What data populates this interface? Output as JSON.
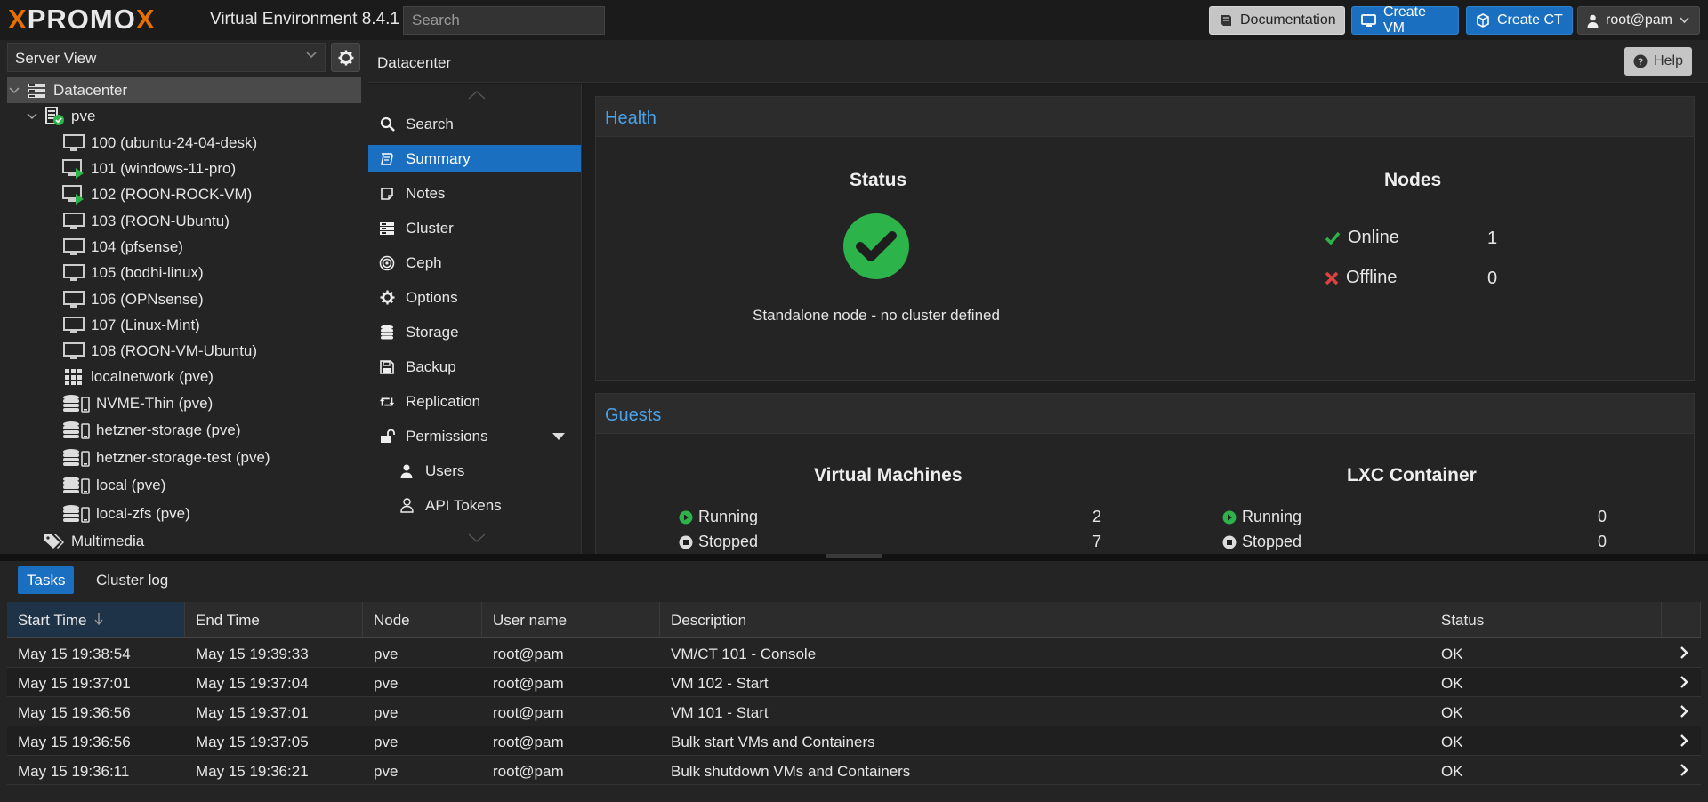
{
  "topbar": {
    "logo_text_pro": "PRO",
    "logo_text_x": "X",
    "logo_text_mox": "MO",
    "logo_text_x2": "X",
    "product": "Virtual Environment 8.4.1",
    "search_placeholder": "Search",
    "documentation_label": "Documentation",
    "create_vm_label": "Create VM",
    "create_ct_label": "Create CT",
    "user_label": "root@pam"
  },
  "left": {
    "view_select": "Server View",
    "tree": [
      {
        "label": "Datacenter",
        "icon": "datacenter-icon"
      },
      {
        "label": "pve",
        "icon": "node-online-icon"
      },
      {
        "label": "100 (ubuntu-24-04-desk)",
        "icon": "vm-stopped-icon"
      },
      {
        "label": "101 (windows-11-pro)",
        "icon": "vm-running-icon"
      },
      {
        "label": "102 (ROON-ROCK-VM)",
        "icon": "vm-running-icon"
      },
      {
        "label": "103 (ROON-Ubuntu)",
        "icon": "vm-stopped-icon"
      },
      {
        "label": "104 (pfsense)",
        "icon": "vm-stopped-icon"
      },
      {
        "label": "105 (bodhi-linux)",
        "icon": "vm-stopped-icon"
      },
      {
        "label": "106 (OPNsense)",
        "icon": "vm-stopped-icon"
      },
      {
        "label": "107 (Linux-Mint)",
        "icon": "vm-stopped-icon"
      },
      {
        "label": "108 (ROON-VM-Ubuntu)",
        "icon": "vm-stopped-icon"
      },
      {
        "label": "localnetwork (pve)",
        "icon": "network-grid-icon"
      },
      {
        "label": "NVME-Thin (pve)",
        "icon": "storage-icon"
      },
      {
        "label": "hetzner-storage (pve)",
        "icon": "storage-icon"
      },
      {
        "label": "hetzner-storage-test (pve)",
        "icon": "storage-icon"
      },
      {
        "label": "local (pve)",
        "icon": "storage-icon"
      },
      {
        "label": "local-zfs (pve)",
        "icon": "storage-icon"
      },
      {
        "label": "Multimedia",
        "icon": "tags-icon"
      }
    ]
  },
  "main": {
    "title": "Datacenter",
    "help_label": "Help"
  },
  "submenu": [
    {
      "label": "Search",
      "icon": "search-icon"
    },
    {
      "label": "Summary",
      "icon": "book-icon",
      "selected": true
    },
    {
      "label": "Notes",
      "icon": "note-icon"
    },
    {
      "label": "Cluster",
      "icon": "server-icon"
    },
    {
      "label": "Ceph",
      "icon": "ceph-icon"
    },
    {
      "label": "Options",
      "icon": "gear-icon"
    },
    {
      "label": "Storage",
      "icon": "database-icon"
    },
    {
      "label": "Backup",
      "icon": "floppy-icon"
    },
    {
      "label": "Replication",
      "icon": "retweet-icon"
    },
    {
      "label": "Permissions",
      "icon": "unlock-icon"
    },
    {
      "label": "Users",
      "icon": "user-icon",
      "sub": true
    },
    {
      "label": "API Tokens",
      "icon": "user-outline-icon",
      "sub": true
    }
  ],
  "health": {
    "title": "Health",
    "status_heading": "Status",
    "status_text": "Standalone node - no cluster defined",
    "nodes_heading": "Nodes",
    "online_label": "Online",
    "online_value": "1",
    "offline_label": "Offline",
    "offline_value": "0"
  },
  "guests": {
    "title": "Guests",
    "vm_heading": "Virtual Machines",
    "vm_running_label": "Running",
    "vm_running_value": "2",
    "vm_stopped_label": "Stopped",
    "vm_stopped_value": "7",
    "lxc_heading": "LXC Container",
    "lxc_running_label": "Running",
    "lxc_running_value": "0",
    "lxc_stopped_label": "Stopped",
    "lxc_stopped_value": "0"
  },
  "bottom": {
    "tabs": [
      "Tasks",
      "Cluster log"
    ],
    "columns": [
      "Start Time",
      "End Time",
      "Node",
      "User name",
      "Description",
      "Status"
    ],
    "rows": [
      [
        "May 15 19:38:54",
        "May 15 19:39:33",
        "pve",
        "root@pam",
        "VM/CT 101 - Console",
        "OK"
      ],
      [
        "May 15 19:37:01",
        "May 15 19:37:04",
        "pve",
        "root@pam",
        "VM 102 - Start",
        "OK"
      ],
      [
        "May 15 19:36:56",
        "May 15 19:37:01",
        "pve",
        "root@pam",
        "VM 101 - Start",
        "OK"
      ],
      [
        "May 15 19:36:56",
        "May 15 19:37:05",
        "pve",
        "root@pam",
        "Bulk start VMs and Containers",
        "OK"
      ],
      [
        "May 15 19:36:11",
        "May 15 19:36:21",
        "pve",
        "root@pam",
        "Bulk shutdown VMs and Containers",
        "OK"
      ]
    ]
  },
  "colors": {
    "accent": "#1a6fc0",
    "brand_orange": "#e57000",
    "ok_green": "#2cb34a",
    "error_red": "#e04040",
    "link_blue": "#4aa3e8"
  }
}
